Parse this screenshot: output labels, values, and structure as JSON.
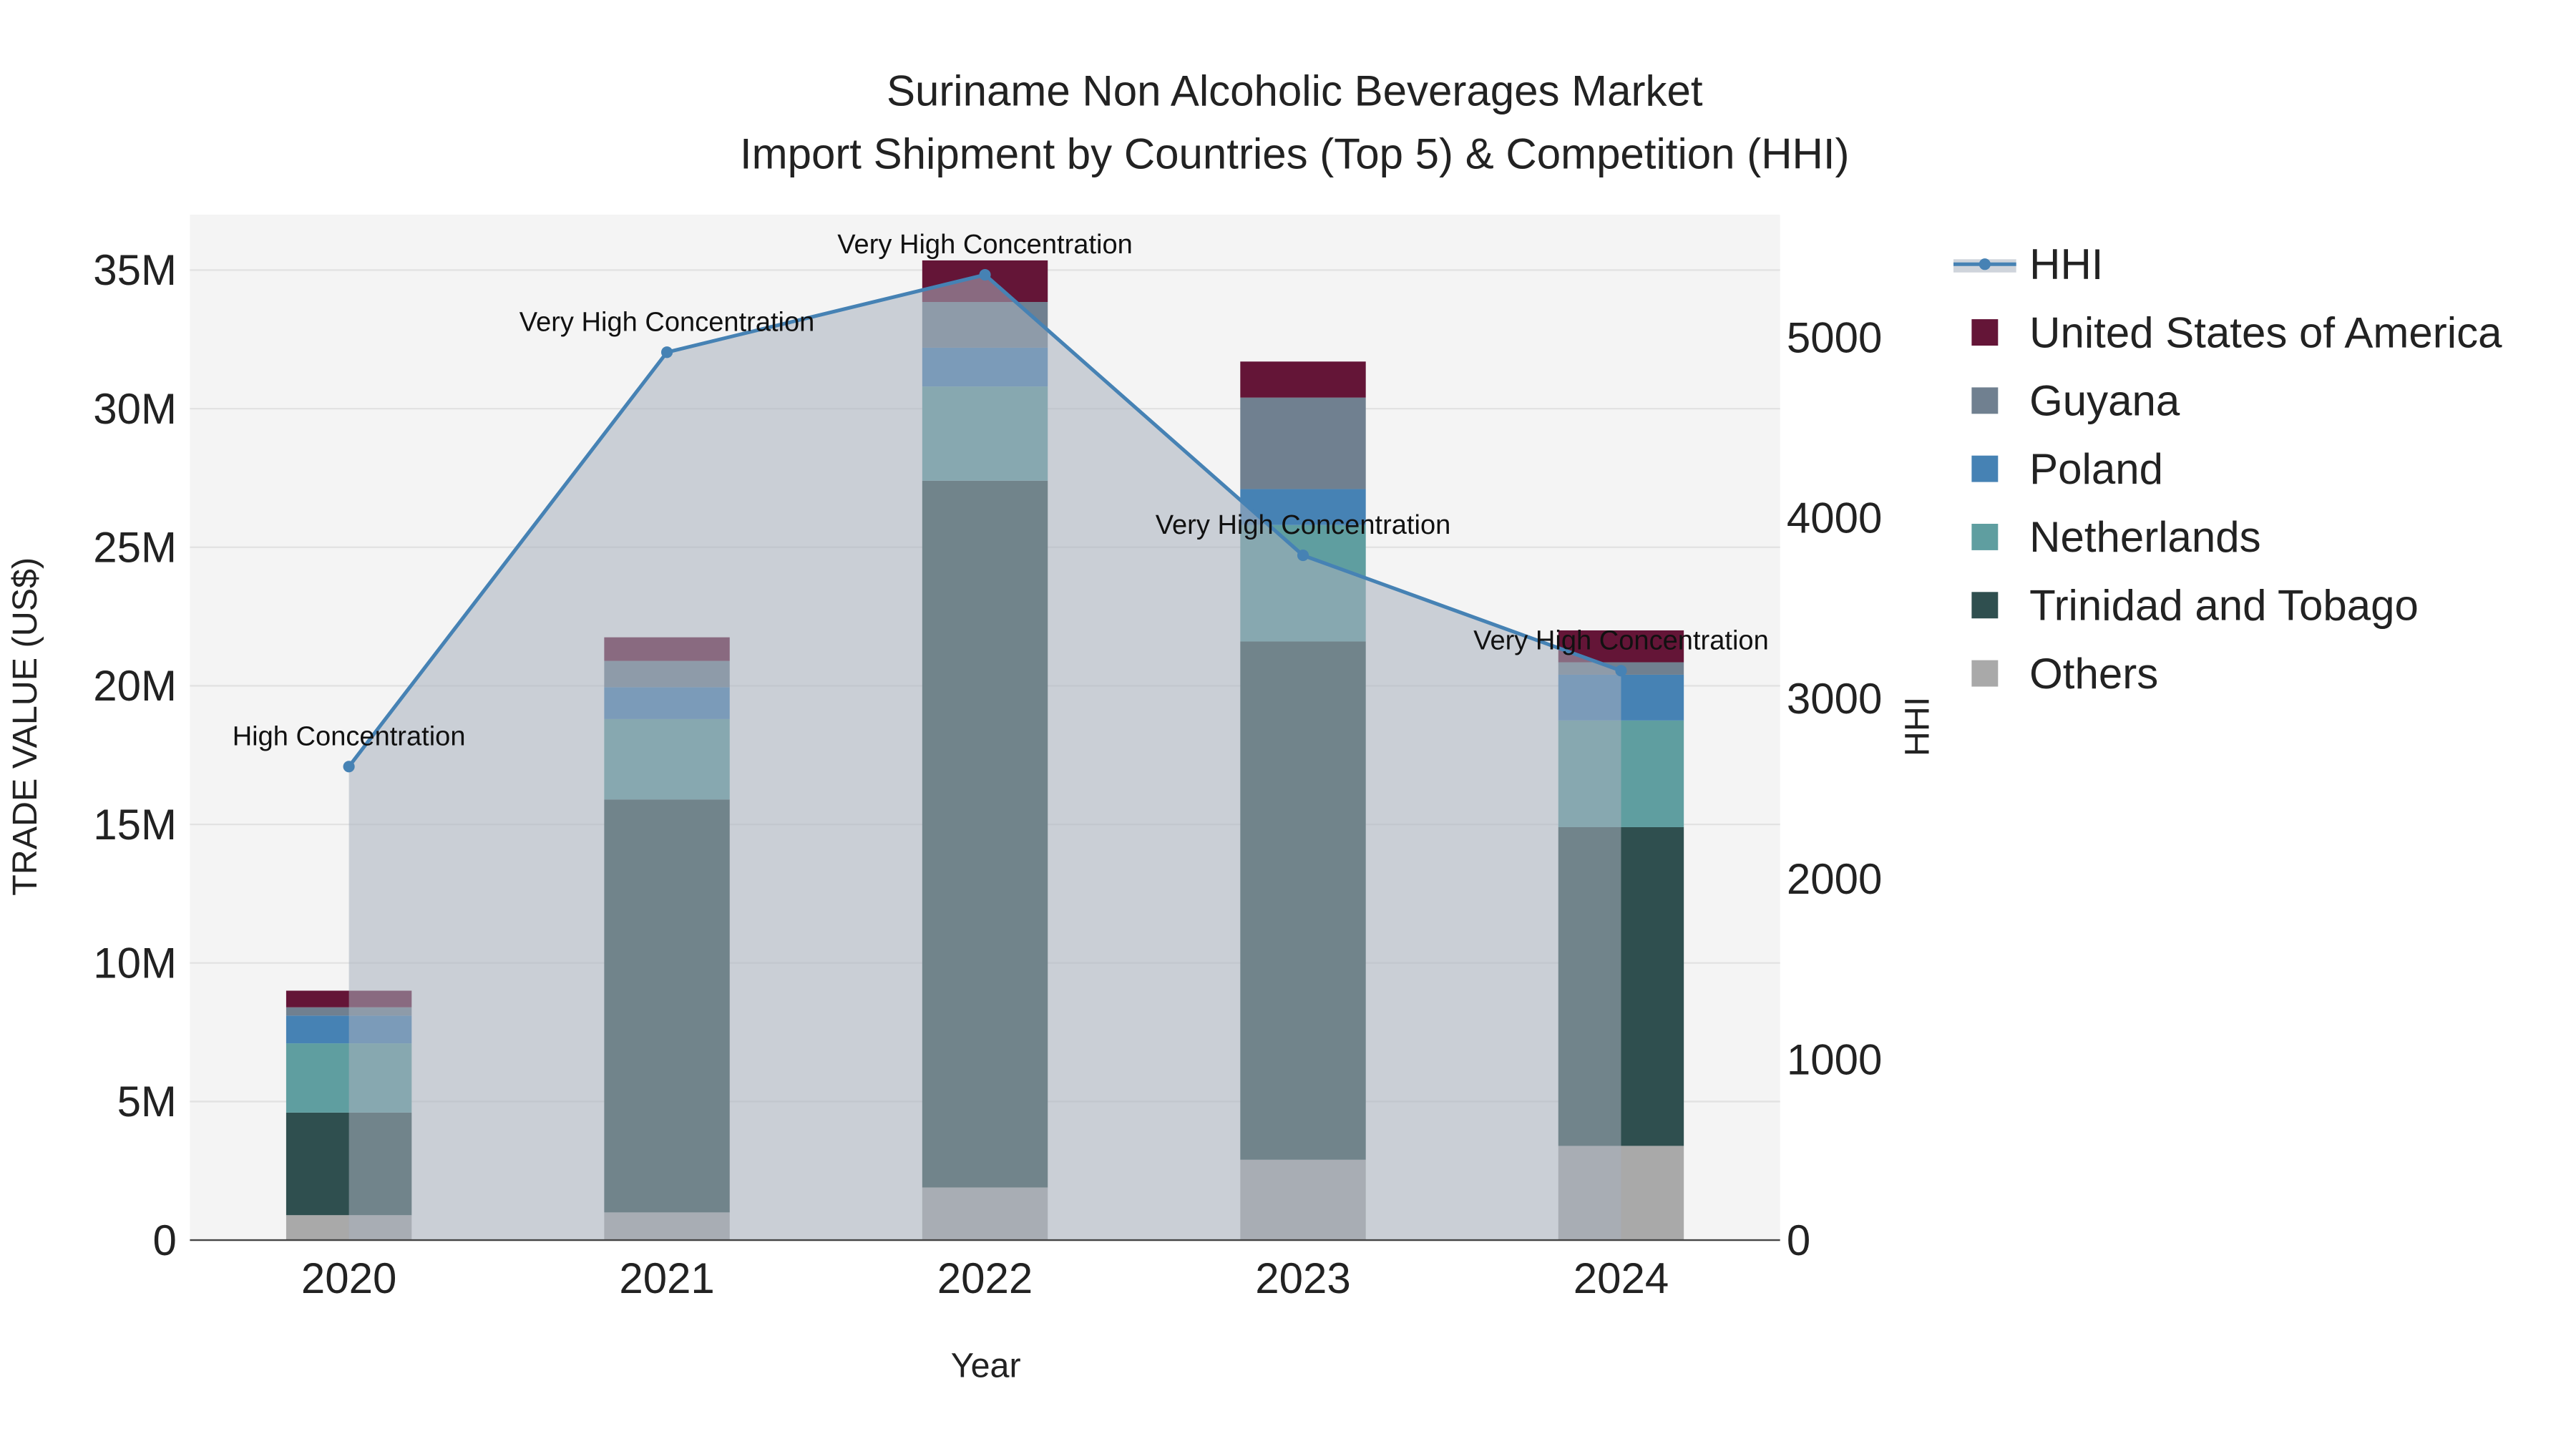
{
  "chart_data": {
    "type": "bar",
    "title_line1": "Suriname Non Alcoholic Beverages Market",
    "title_line2": "Import Shipment by Countries (Top 5) & Competition (HHI)",
    "xlabel": "Year",
    "ylabel": "TRADE VALUE (US$)",
    "y2label": "HHI",
    "categories": [
      "2020",
      "2021",
      "2022",
      "2023",
      "2024"
    ],
    "ylim": [
      0,
      37000000
    ],
    "y_ticks": [
      0,
      5000000,
      10000000,
      15000000,
      20000000,
      25000000,
      30000000,
      35000000
    ],
    "y_tick_labels": [
      "0",
      "5M",
      "10M",
      "15M",
      "20M",
      "25M",
      "30M",
      "35M"
    ],
    "y2lim": [
      0,
      5680
    ],
    "y2_ticks": [
      0,
      1000,
      2000,
      3000,
      4000,
      5000
    ],
    "y2_tick_labels": [
      "0",
      "1000",
      "2000",
      "3000",
      "4000",
      "5000"
    ],
    "stacked": true,
    "series": [
      {
        "name": "Others",
        "color": "#a9a9a9",
        "values": [
          900000,
          1000000,
          1900000,
          2900000,
          3400000
        ]
      },
      {
        "name": "Trinidad and Tobago",
        "color": "#2f4f4f",
        "values": [
          3700000,
          14900000,
          25500000,
          18700000,
          11500000
        ]
      },
      {
        "name": "Netherlands",
        "color": "#5f9ea0",
        "values": [
          2500000,
          2900000,
          3400000,
          4200000,
          3850000
        ]
      },
      {
        "name": "Poland",
        "color": "#4682b4",
        "values": [
          1000000,
          1150000,
          1400000,
          1300000,
          1650000
        ]
      },
      {
        "name": "Guyana",
        "color": "#708090",
        "values": [
          300000,
          950000,
          1650000,
          3300000,
          450000
        ]
      },
      {
        "name": "United States of America",
        "color": "#641537",
        "values": [
          600000,
          850000,
          1500000,
          1300000,
          1150000
        ]
      }
    ],
    "hhi": {
      "name": "HHI",
      "color": "#4682b4",
      "values": [
        2623,
        4918,
        5347,
        3793,
        3154
      ],
      "labels": [
        "High Concentration",
        "Very High Concentration",
        "Very High Concentration",
        "Very High Concentration",
        "Very High Concentration"
      ]
    },
    "legend_order": [
      "HHI",
      "United States of America",
      "Guyana",
      "Poland",
      "Netherlands",
      "Trinidad and Tobago",
      "Others"
    ],
    "legend_placement": "right",
    "grid": true
  }
}
